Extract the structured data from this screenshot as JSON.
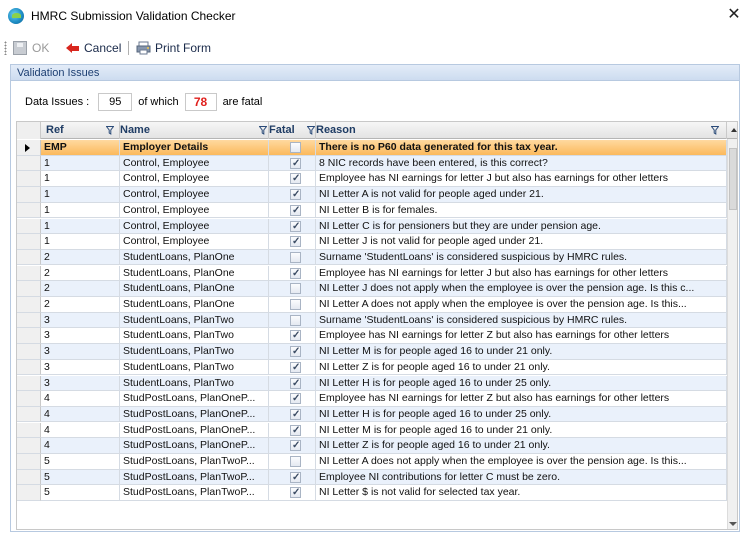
{
  "window": {
    "title": "HMRC Submission Validation Checker"
  },
  "toolbar": {
    "ok_label": "OK",
    "cancel_label": "Cancel",
    "print_label": "Print Form"
  },
  "group": {
    "title": "Validation Issues"
  },
  "issues": {
    "data_issues_label": "Data Issues :",
    "total": "95",
    "of_which_label": "of which",
    "fatal": "78",
    "are_fatal_label": "are fatal"
  },
  "grid": {
    "columns": {
      "ref": "Ref",
      "name": "Name",
      "fatal": "Fatal",
      "reason": "Reason"
    },
    "rows": [
      {
        "ref": "EMP",
        "name": "Employer Details",
        "fatal": false,
        "reason": "There is no P60 data generated for this tax year.",
        "selected": true
      },
      {
        "ref": "1",
        "name": "Control, Employee",
        "fatal": true,
        "reason": "8 NIC records have been entered, is this correct?"
      },
      {
        "ref": "1",
        "name": "Control, Employee",
        "fatal": true,
        "reason": "Employee has NI earnings for letter J but also has earnings for other letters"
      },
      {
        "ref": "1",
        "name": "Control, Employee",
        "fatal": true,
        "reason": "NI Letter A  is not valid for people aged under 21."
      },
      {
        "ref": "1",
        "name": "Control, Employee",
        "fatal": true,
        "reason": "NI Letter B is for females."
      },
      {
        "ref": "1",
        "name": "Control, Employee",
        "fatal": true,
        "reason": "NI Letter C  is for pensioners but they are under pension age."
      },
      {
        "ref": "1",
        "name": "Control, Employee",
        "fatal": true,
        "reason": "NI Letter J  is not valid for people aged under 21."
      },
      {
        "ref": "2",
        "name": "StudentLoans, PlanOne",
        "fatal": false,
        "reason": "Surname 'StudentLoans' is considered suspicious by HMRC rules."
      },
      {
        "ref": "2",
        "name": "StudentLoans, PlanOne",
        "fatal": true,
        "reason": "Employee has NI earnings for letter J but also has earnings for other letters"
      },
      {
        "ref": "2",
        "name": "StudentLoans, PlanOne",
        "fatal": false,
        "reason": "NI Letter J does not apply when the employee is over the pension age. Is this c..."
      },
      {
        "ref": "2",
        "name": "StudentLoans, PlanOne",
        "fatal": false,
        "reason": "NI Letter A does not apply when the employee is over the pension age. Is this..."
      },
      {
        "ref": "3",
        "name": "StudentLoans, PlanTwo",
        "fatal": false,
        "reason": "Surname 'StudentLoans' is considered suspicious by HMRC rules."
      },
      {
        "ref": "3",
        "name": "StudentLoans, PlanTwo",
        "fatal": true,
        "reason": "Employee has NI earnings for letter Z but also has earnings for other letters"
      },
      {
        "ref": "3",
        "name": "StudentLoans, PlanTwo",
        "fatal": true,
        "reason": "NI Letter M  is for people aged 16 to under 21 only."
      },
      {
        "ref": "3",
        "name": "StudentLoans, PlanTwo",
        "fatal": true,
        "reason": "NI Letter Z  is for people aged 16 to under 21 only."
      },
      {
        "ref": "3",
        "name": "StudentLoans, PlanTwo",
        "fatal": true,
        "reason": "NI Letter H  is for people aged 16 to under 25 only."
      },
      {
        "ref": "4",
        "name": "StudPostLoans,  PlanOneP...",
        "fatal": true,
        "reason": "Employee has NI earnings for letter Z but also has earnings for other letters"
      },
      {
        "ref": "4",
        "name": "StudPostLoans,  PlanOneP...",
        "fatal": true,
        "reason": "NI Letter H  is for people aged 16 to under 25 only."
      },
      {
        "ref": "4",
        "name": "StudPostLoans,  PlanOneP...",
        "fatal": true,
        "reason": "NI Letter M  is for people aged 16 to under 21 only."
      },
      {
        "ref": "4",
        "name": "StudPostLoans,  PlanOneP...",
        "fatal": true,
        "reason": "NI Letter Z  is for people aged 16 to under 21 only."
      },
      {
        "ref": "5",
        "name": "StudPostLoans,  PlanTwoP...",
        "fatal": false,
        "reason": "NI Letter A does not apply when the employee is over the pension age. Is this..."
      },
      {
        "ref": "5",
        "name": "StudPostLoans,  PlanTwoP...",
        "fatal": true,
        "reason": "Employee NI contributions for letter C must be zero."
      },
      {
        "ref": "5",
        "name": "StudPostLoans,  PlanTwoP...",
        "fatal": true,
        "reason": "NI Letter $ is not valid for selected tax year."
      }
    ]
  }
}
